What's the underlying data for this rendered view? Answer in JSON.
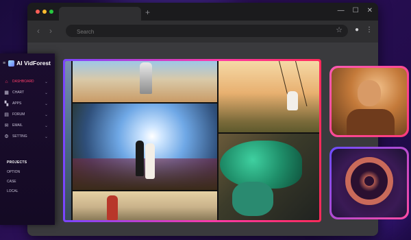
{
  "browser": {
    "search_placeholder": "Search"
  },
  "app": {
    "name": "AI VidForest"
  },
  "sidebar": {
    "items": [
      {
        "label": "DASHBOARD"
      },
      {
        "label": "CHART"
      },
      {
        "label": "APPS"
      },
      {
        "label": "FORUM"
      },
      {
        "label": "EMAIL"
      },
      {
        "label": "SETTING"
      }
    ],
    "section_title": "PROJECTS",
    "projects": [
      {
        "label": "OPTION"
      },
      {
        "label": "CASE"
      },
      {
        "label": "LOCAL"
      }
    ]
  },
  "colors": {
    "accent": "#ff3c6a",
    "frame_gradient_start": "#7a45ff",
    "frame_gradient_end": "#ff2a5a"
  }
}
